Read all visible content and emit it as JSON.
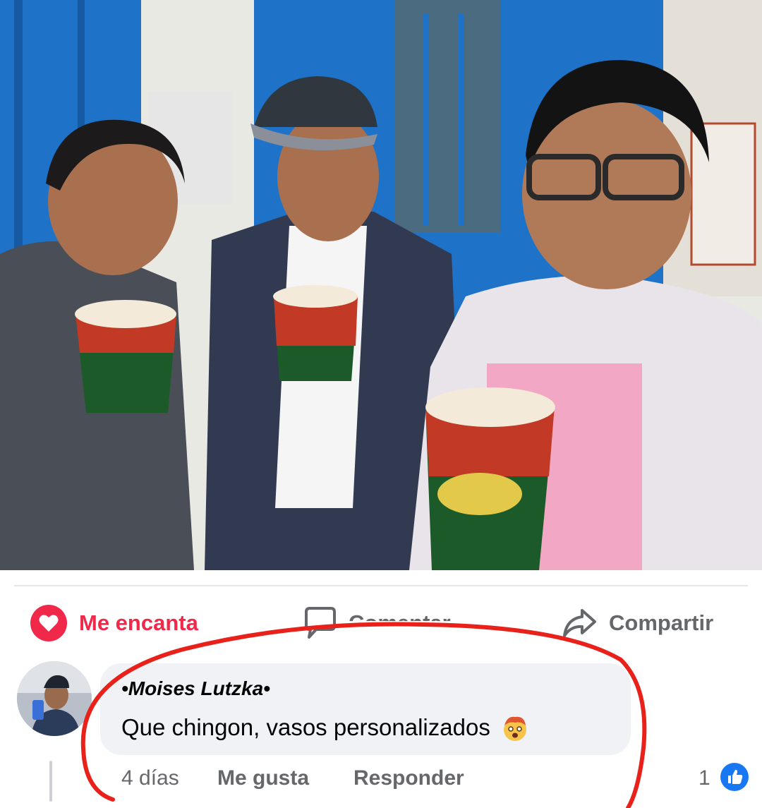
{
  "post": {
    "photo_icon": "photo-three-friends-with-cups",
    "actions": {
      "love_label": "Me encanta",
      "comment_label": "Comentar",
      "share_label": "Compartir"
    }
  },
  "comment": {
    "author": "•Moises Lutzka•",
    "text": "Que chingon, vasos personalizados",
    "emoji": "exploding-head-emoji",
    "time": "4 días",
    "like_label": "Me gusta",
    "reply_label": "Responder",
    "reaction_count": "1",
    "reaction_icon": "like-thumb-icon"
  },
  "colors": {
    "love": "#f0284a",
    "secondary_text": "#65676b",
    "bubble": "#f0f2f5",
    "annotation_circle": "#e8221b",
    "like_blue": "#1877f2"
  }
}
